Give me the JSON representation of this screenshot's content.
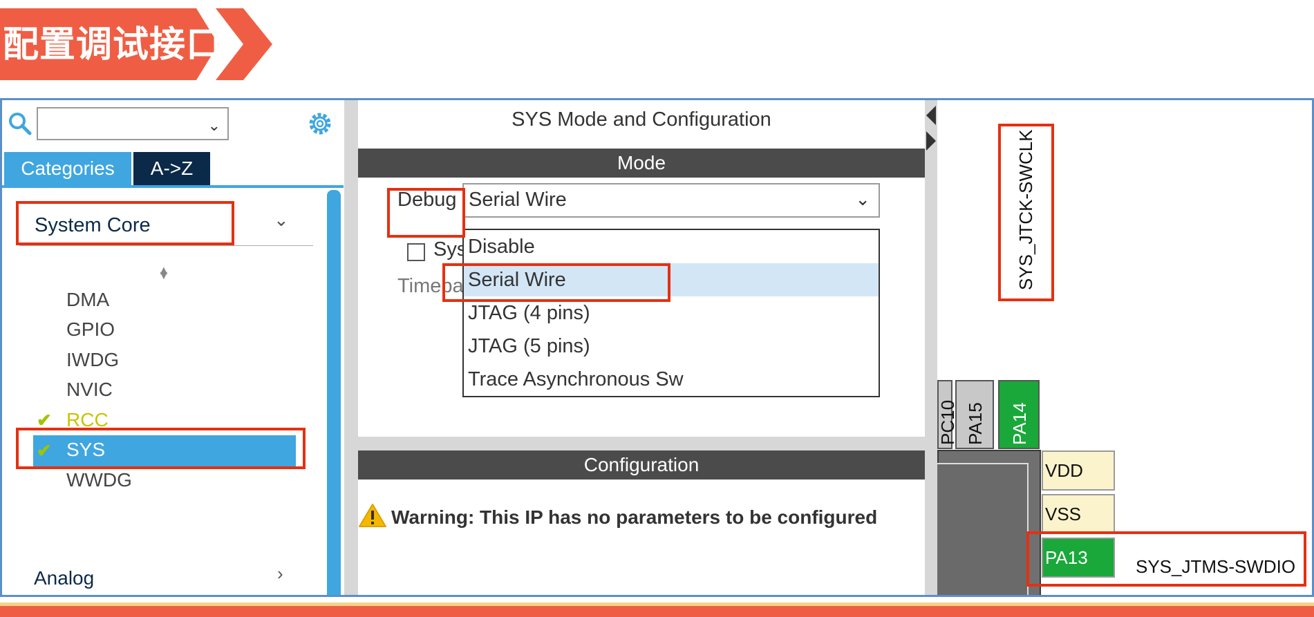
{
  "banner": {
    "title": "配置调试接口",
    "color": "#ef5e44"
  },
  "left_panel": {
    "search": {
      "value": "",
      "placeholder": ""
    },
    "tabs": [
      {
        "label": "Categories"
      },
      {
        "label": "A->Z"
      }
    ],
    "category": {
      "label": "System Core"
    },
    "items": [
      {
        "label": "DMA",
        "checked": false
      },
      {
        "label": "GPIO",
        "checked": false
      },
      {
        "label": "IWDG",
        "checked": false
      },
      {
        "label": "NVIC",
        "checked": false
      },
      {
        "label": "RCC",
        "checked": true
      },
      {
        "label": "SYS",
        "checked": true,
        "selected": true
      },
      {
        "label": "WWDG",
        "checked": false
      }
    ],
    "next_category": {
      "label": "Analog"
    }
  },
  "middle_panel": {
    "title": "SYS Mode and Configuration",
    "mode_header": "Mode",
    "debug_label": "Debug",
    "debug_value": "Serial Wire",
    "checkbox_label": "Sys",
    "timebase_label": "Timeba",
    "debug_options": [
      "Disable",
      "Serial Wire",
      "JTAG (4 pins)",
      "JTAG (5 pins)",
      "Trace Asynchronous Sw"
    ],
    "selected_option": "Serial Wire",
    "config_header": "Configuration",
    "warning": "Warning: This IP has no parameters to be configured"
  },
  "chip_view": {
    "top_pins": [
      {
        "label": "PC10",
        "color": "gray"
      },
      {
        "label": "PA15",
        "color": "gray"
      },
      {
        "label": "PA14",
        "color": "green"
      }
    ],
    "swclk_label": "SYS_JTCK-SWCLK",
    "right_pins": [
      {
        "label": "VDD",
        "color": "beige"
      },
      {
        "label": "VSS",
        "color": "beige"
      },
      {
        "label": "PA13",
        "color": "green"
      }
    ],
    "swdio_label": "SYS_JTMS-SWDIO"
  },
  "colors": {
    "accent": "#3fa6e0",
    "highlight": "#e53012",
    "pin_green": "#1aa83a"
  }
}
